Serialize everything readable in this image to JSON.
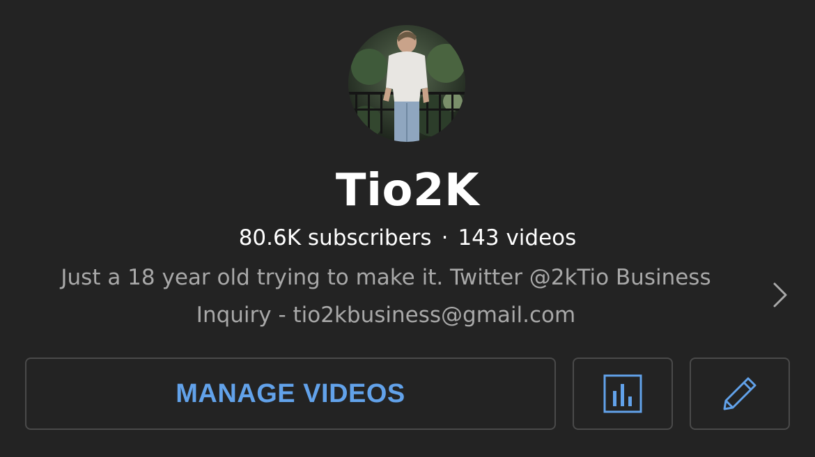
{
  "channel": {
    "name": "Tio2K",
    "subscribers": "80.6K subscribers",
    "separator": "·",
    "videos": "143 videos",
    "description": "Just a 18 year old trying to make it. Twitter @2kTio Business Inquiry - tio2kbusiness@gmail.com"
  },
  "actions": {
    "manage_label": "MANAGE VIDEOS",
    "analytics_icon": "bar-chart-icon",
    "edit_icon": "pencil-icon"
  },
  "colors": {
    "background": "#232323",
    "accent": "#62a2ea",
    "secondary_text": "#a9a9a9",
    "border": "#4a4a4a"
  }
}
